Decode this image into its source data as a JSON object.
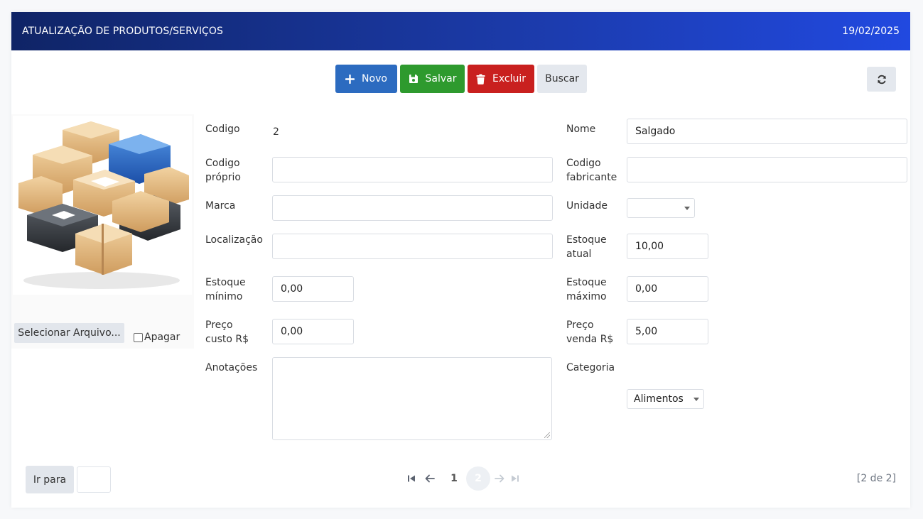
{
  "header": {
    "title": "ATUALIZAÇÃO DE PRODUTOS/SERVIÇOS",
    "date": "19/02/2025"
  },
  "toolbar": {
    "novo": "Novo",
    "salvar": "Salvar",
    "excluir": "Excluir",
    "buscar": "Buscar",
    "refresh_icon": "refresh-icon"
  },
  "image_panel": {
    "select_file": "Selecionar Arquivo...",
    "apagar": "Apagar",
    "apagar_checked": false
  },
  "form": {
    "codigo": {
      "label": "Codigo",
      "value": "2"
    },
    "nome": {
      "label": "Nome",
      "value": "Salgado"
    },
    "codigo_proprio": {
      "label1": "Codigo",
      "label2": "próprio",
      "value": ""
    },
    "codigo_fabricante": {
      "label1": "Codigo",
      "label2": "fabricante",
      "value": ""
    },
    "marca": {
      "label": "Marca",
      "value": ""
    },
    "unidade": {
      "label": "Unidade",
      "value": ""
    },
    "localizacao": {
      "label": "Localização",
      "value": ""
    },
    "estoque_atual": {
      "label1": "Estoque",
      "label2": "atual",
      "value": "10,00"
    },
    "estoque_minimo": {
      "label1": "Estoque",
      "label2": "mínimo",
      "value": "0,00"
    },
    "estoque_maximo": {
      "label1": "Estoque",
      "label2": "máximo",
      "value": "0,00"
    },
    "preco_custo": {
      "label1": "Preço",
      "label2": "custo R$",
      "value": "0,00"
    },
    "preco_venda": {
      "label1": "Preço",
      "label2": "venda R$",
      "value": "5,00"
    },
    "anotacoes": {
      "label": "Anotações",
      "value": ""
    },
    "categoria": {
      "label": "Categoria",
      "value": "Alimentos"
    }
  },
  "footer": {
    "ir_para": "Ir para",
    "pages": [
      "1",
      "2"
    ],
    "current_page": "2",
    "page_info": "[2 de 2]"
  },
  "colors": {
    "header_start": "#0f2466",
    "header_end": "#2149e0",
    "novo": "#2c6bc0",
    "salvar": "#2e9a2e",
    "excluir": "#c9201f",
    "neutral_button": "#e4e8ee"
  }
}
